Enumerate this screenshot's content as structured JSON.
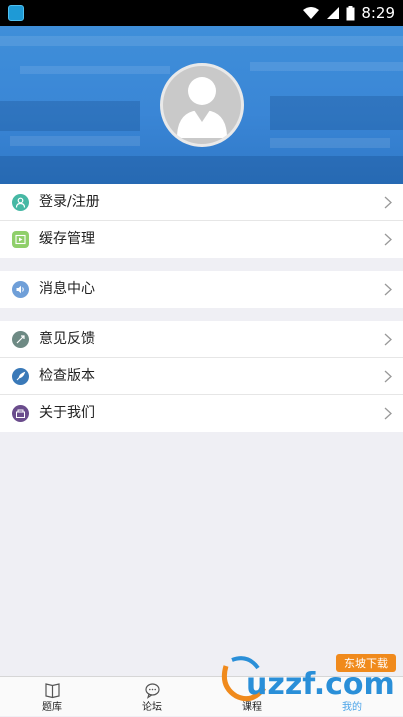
{
  "status_bar": {
    "time": "8:29"
  },
  "menu": {
    "group1": [
      {
        "label": "登录/注册",
        "icon": "user-icon",
        "color": "#46b8a4"
      },
      {
        "label": "缓存管理",
        "icon": "cache-icon",
        "color": "#8fcf6a"
      }
    ],
    "group2": [
      {
        "label": "消息中心",
        "icon": "speaker-icon",
        "color": "#6f9fd8"
      }
    ],
    "group3": [
      {
        "label": "意见反馈",
        "icon": "feedback-icon",
        "color": "#6e8a84"
      },
      {
        "label": "检查版本",
        "icon": "rocket-icon",
        "color": "#3a79b8"
      },
      {
        "label": "关于我们",
        "icon": "about-icon",
        "color": "#6a4c8c"
      }
    ]
  },
  "tabs": [
    {
      "label": "题库",
      "icon": "book-icon"
    },
    {
      "label": "论坛",
      "icon": "chat-icon"
    },
    {
      "label": "课程",
      "icon": "course-icon"
    },
    {
      "label": "我的",
      "icon": "profile-icon",
      "active": true
    }
  ],
  "watermark": {
    "text": "uzzf.com",
    "badge": "东坡下载"
  },
  "colors": {
    "hero": "#3a86d6",
    "active_tab": "#4aa3e8"
  }
}
